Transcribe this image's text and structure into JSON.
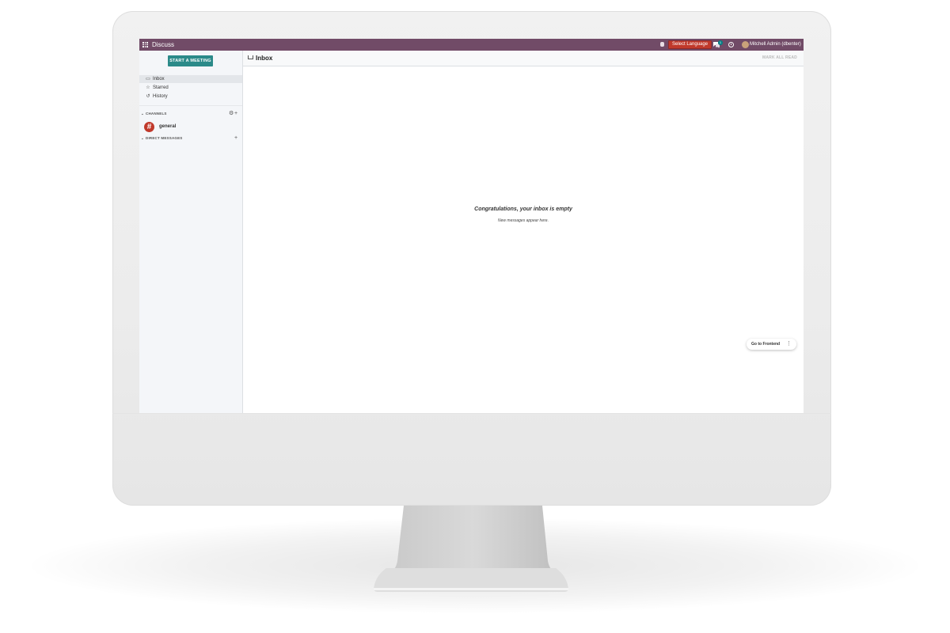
{
  "topbar": {
    "app_name": "Discuss",
    "language_button": "Select Language",
    "chat_badge": "1",
    "user": "Mitchell Admin (dbenter)",
    "brand_color": "#714b67",
    "language_button_color": "#c0392b"
  },
  "sidebar": {
    "start_meeting": "START A MEETING",
    "items": [
      {
        "label": "Inbox",
        "icon": "inbox-icon",
        "active": true
      },
      {
        "label": "Starred",
        "icon": "star-icon",
        "active": false
      },
      {
        "label": "History",
        "icon": "history-icon",
        "active": false
      }
    ],
    "channels_header": "CHANNELS",
    "channels": [
      {
        "name": "general",
        "avatar": "#"
      }
    ],
    "dm_header": "DIRECT MESSAGES",
    "accent_color": "#2b8a89"
  },
  "main": {
    "title": "Inbox",
    "mark_all_read": "MARK ALL READ",
    "empty_title": "Congratulations, your inbox is empty",
    "empty_subtitle": "New messages appear here."
  },
  "floating": {
    "go_to_frontend": "Go to Frontend",
    "menu_glyph": "⋮"
  }
}
